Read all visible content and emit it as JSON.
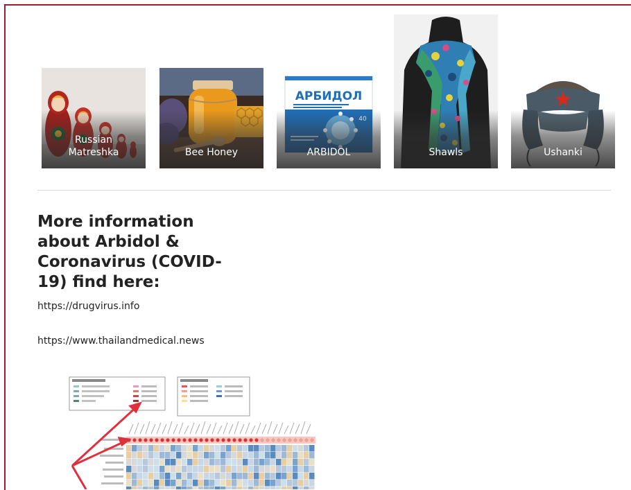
{
  "categories": [
    {
      "label": "Russian Matreshka",
      "icon": "matryoshka-image"
    },
    {
      "label": "Bee Honey",
      "icon": "honey-jar-image"
    },
    {
      "label": "ARBIDOL",
      "icon": "medicine-box-image"
    },
    {
      "label": "Shawls",
      "icon": "scarf-image"
    },
    {
      "label": "Ushanki",
      "icon": "fur-hat-image"
    }
  ],
  "arbidol_box": {
    "brand": "АРБИДОЛ",
    "count": "40"
  },
  "info": {
    "heading": "More information about Arbidol & Coronavirus (COVID-19) find here:",
    "links": [
      "https://drugvirus.info",
      "https://www.thailandmedical.news"
    ]
  },
  "colors": {
    "frame_border": "#a3182f",
    "divider": "#d6d6d6",
    "text": "#222222",
    "arbidol_blue": "#1f6fb8",
    "figure_arrow": "#e0303c"
  }
}
